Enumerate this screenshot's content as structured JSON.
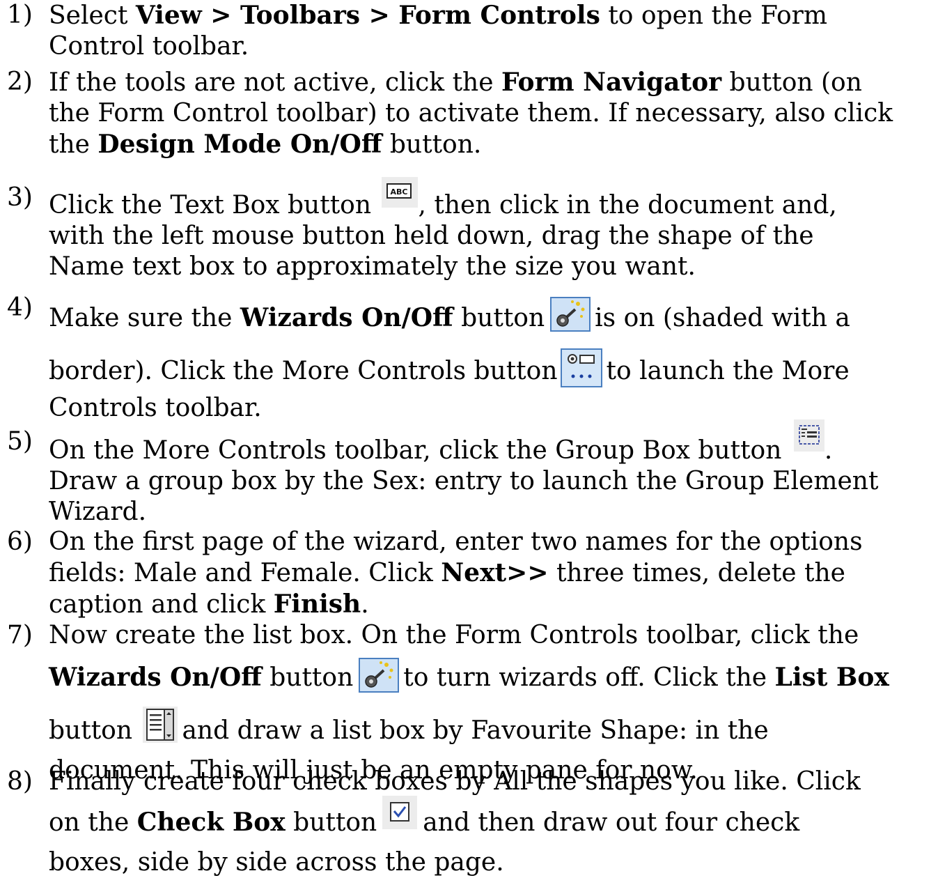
{
  "steps": [
    {
      "number": "1)",
      "lines": [
        [
          "Select ",
          {
            "b": "View > Toolbars > Form Controls"
          },
          " to open the Form"
        ],
        [
          "Control toolbar."
        ]
      ]
    },
    {
      "number": "2)",
      "lines": [
        [
          "If the tools are not active, click the ",
          {
            "b": "Form Navigator"
          },
          " button (on"
        ],
        [
          "the Form Control toolbar) to activate them. If necessary, also click"
        ],
        [
          "the ",
          {
            "b": "Design Mode On/Off"
          },
          " button."
        ]
      ]
    },
    {
      "number": "3)",
      "lines": [
        [
          "Click the Text Box button ",
          {
            "icon": "textbox-icon"
          },
          ", then click in the document and,"
        ],
        [
          "with the left mouse button held down, drag the shape of the"
        ],
        [
          "Name text box to approximately the size you want."
        ]
      ]
    },
    {
      "number": "4)",
      "lines": [
        [
          "Make sure the ",
          {
            "b": "Wizards On/Off"
          },
          " button",
          {
            "icon": "wizard-icon"
          },
          "is on (shaded with a"
        ],
        [
          "border). Click the More Controls button",
          {
            "icon": "more-controls-icon"
          },
          "to launch the More"
        ],
        [
          "Controls toolbar."
        ]
      ]
    },
    {
      "number": "5)",
      "lines": [
        [
          "On the More Controls toolbar, click the Group Box button ",
          {
            "icon": "group-box-icon"
          },
          "."
        ],
        [
          "Draw a group box by the Sex: entry to launch the Group Element"
        ],
        [
          "Wizard."
        ]
      ]
    },
    {
      "number": "6)",
      "lines": [
        [
          "On the first page of the wizard, enter two names for the options"
        ],
        [
          "fields: Male and Female. Click ",
          {
            "b": "Next>>"
          },
          " three times, delete the"
        ],
        [
          "caption and click ",
          {
            "b": "Finish"
          },
          "."
        ]
      ]
    },
    {
      "number": "7)",
      "lines": [
        [
          "Now create the list box. On the Form Controls toolbar, click the"
        ],
        [
          {
            "b": "Wizards On/Off"
          },
          " button",
          {
            "icon": "wizard-icon"
          },
          "to turn wizards off. Click the ",
          {
            "b": "List Box"
          }
        ],
        [
          "button ",
          {
            "icon": "list-box-icon"
          },
          "and draw a list box by Favourite Shape: in the"
        ],
        [
          "document. This will just be an empty pane for now."
        ]
      ]
    },
    {
      "number": "8)",
      "lines": [
        [
          "Finally create four check boxes by All the shapes you like. Click"
        ],
        [
          "on the ",
          {
            "b": "Check Box"
          },
          " button",
          {
            "icon": "check-box-icon"
          },
          "and then draw out four check"
        ],
        [
          "boxes, side by side across the page."
        ]
      ]
    }
  ]
}
